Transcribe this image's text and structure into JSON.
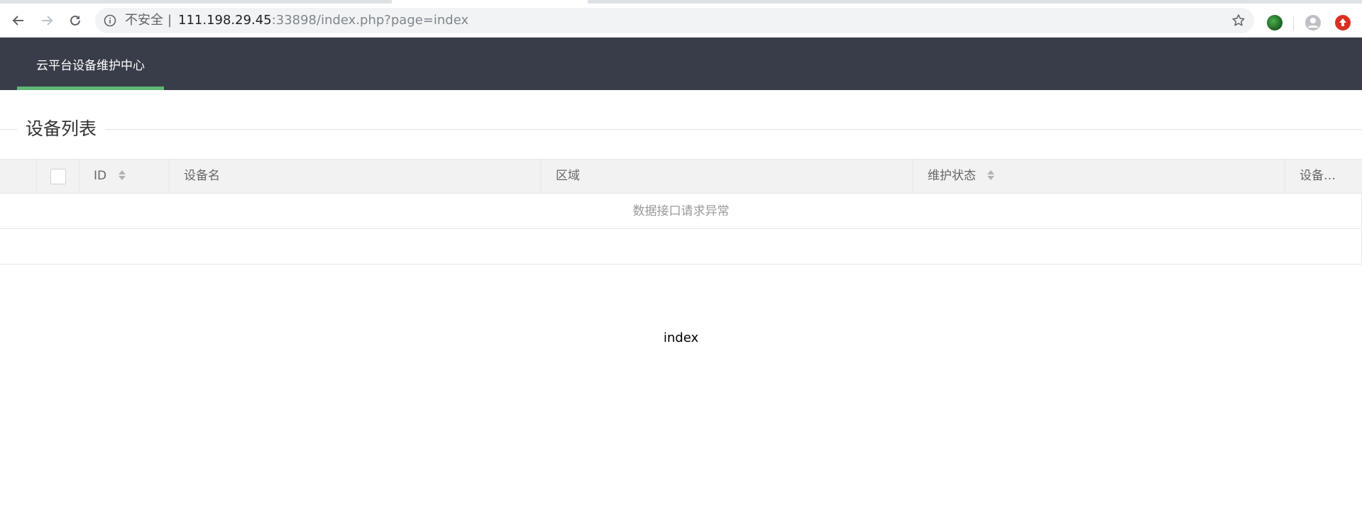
{
  "browser": {
    "security_label": "不安全",
    "separator": "|",
    "url_host": "111.198.29.45",
    "url_rest": ":33898/index.php?page=index"
  },
  "header": {
    "nav_items": [
      {
        "label": "云平台设备维护中心"
      }
    ],
    "accent_color": "#5fb878",
    "background_color": "#393d49"
  },
  "section": {
    "title": "设备列表"
  },
  "table": {
    "columns": [
      {
        "label": "ID",
        "sortable": true
      },
      {
        "label": "设备名",
        "sortable": false
      },
      {
        "label": "区域",
        "sortable": false
      },
      {
        "label": "维护状态",
        "sortable": true
      },
      {
        "label": "设备…",
        "sortable": false
      }
    ],
    "empty_message": "数据接口请求异常"
  },
  "footer": {
    "text": "index"
  }
}
